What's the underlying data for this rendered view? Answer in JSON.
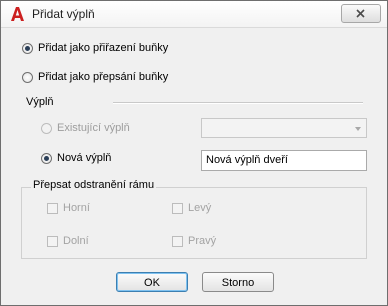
{
  "window": {
    "title": "Přidat výplň",
    "icon": "autocad-a-icon",
    "close_icon": "close-icon"
  },
  "options": {
    "as_cell_assignment": {
      "label": "Přidat jako přiřazení buňky",
      "checked": true
    },
    "as_cell_override": {
      "label": "Přidat jako přepsání buňky",
      "checked": false
    }
  },
  "fill_section": {
    "label": "Výplň",
    "existing": {
      "label": "Existující výplň",
      "checked": false,
      "disabled": true,
      "combo_value": ""
    },
    "new": {
      "label": "Nová výplň",
      "checked": true,
      "value": "Nová výplň dveří"
    }
  },
  "frame_override": {
    "label": "Přepsat odstranění rámu",
    "top": {
      "label": "Horní",
      "checked": false
    },
    "left": {
      "label": "Levý",
      "checked": false
    },
    "bottom": {
      "label": "Dolní",
      "checked": false
    },
    "right": {
      "label": "Pravý",
      "checked": false
    }
  },
  "buttons": {
    "ok": "OK",
    "cancel": "Storno"
  },
  "colors": {
    "accent": "#3c7fb1",
    "app_icon": "#cc1f1f"
  }
}
